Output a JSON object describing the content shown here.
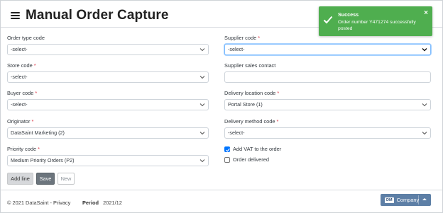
{
  "header": {
    "title": "Manual Order Capture"
  },
  "form": {
    "order_type": {
      "label": "Order type code",
      "value": "-select-"
    },
    "supplier": {
      "label": "Supplier code",
      "value": "-select-"
    },
    "store": {
      "label": "Store code",
      "value": "-select-"
    },
    "supplier_contact": {
      "label": "Supplier sales contact",
      "value": ""
    },
    "buyer": {
      "label": "Buyer code",
      "value": "-select-"
    },
    "delivery_location": {
      "label": "Delivery location code",
      "value": "Portal Store (1)"
    },
    "originator": {
      "label": "Originator",
      "value": "DataSaint Marketing (2)"
    },
    "delivery_method": {
      "label": "Delivery method code",
      "value": "-select-"
    },
    "priority": {
      "label": "Priority code",
      "value": "Medium Priority Orders (P2)"
    },
    "add_vat": {
      "label": "Add VAT to the order",
      "checked": true
    },
    "order_delivered": {
      "label": "Order delivered",
      "checked": false
    },
    "required_marker": "*"
  },
  "actions": {
    "add_line": "Add line",
    "save": "Save",
    "new": "New"
  },
  "footer": {
    "copyright": "© 2021 DataSaint -",
    "privacy": "Privacy",
    "period_label": "Period",
    "period_value": "2021/12",
    "company_badge": "DM",
    "company_label": "Company"
  },
  "toast": {
    "title": "Success",
    "message": "Order number Y471274 successfully posted",
    "close": "×"
  },
  "colors": {
    "success": "#4fae4f",
    "required": "#dc3545",
    "company_button": "#5d7fa6",
    "save_button": "#6c757d"
  }
}
